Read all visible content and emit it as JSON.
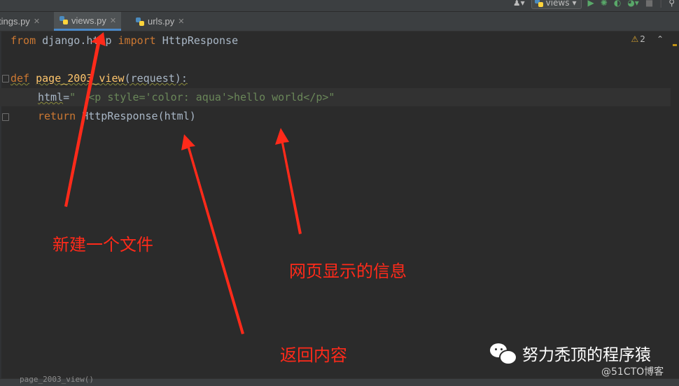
{
  "toolbar": {
    "run_config": "views",
    "user_icon": "user-icon",
    "run_icon": "run-icon",
    "debug_icon": "debug-icon",
    "coverage_icon": "coverage-icon",
    "profile_icon": "profile-icon",
    "stop_icon": "stop-icon",
    "search_icon": "search-icon"
  },
  "tabs": [
    {
      "label": "settings.py",
      "visible_label": "tings.py"
    },
    {
      "label": "views.py"
    },
    {
      "label": "urls.py"
    }
  ],
  "editor": {
    "warning_count": "2",
    "lines": {
      "l1": {
        "kw1": "from",
        "mod": " django.http ",
        "kw2": "import",
        "name": " HttpResponse"
      },
      "l3": {
        "kw": "def",
        "fn": "page_2003_view",
        "params": "(request):"
      },
      "l4": {
        "var": "html",
        "eq": "=",
        "str": "\"  <p style='color: aqua'>hello world</p>\""
      },
      "l5": {
        "kw": "return",
        "call": " HttpResponse(html)"
      }
    }
  },
  "annotations": {
    "new_file": "新建一个文件",
    "page_info": "网页显示的信息",
    "return_content": "返回内容"
  },
  "watermark": {
    "account": "努力秃顶的程序猿",
    "credit": "@51CTO博客"
  },
  "statusbar": {
    "breadcrumb": "page_2003_view()"
  },
  "colors": {
    "editor_bg": "#2b2b2b",
    "keyword": "#cc7832",
    "function": "#ffc66d",
    "string": "#6a8759",
    "annotation": "#ff2a1a",
    "active_tab_underline": "#4a88c7"
  }
}
